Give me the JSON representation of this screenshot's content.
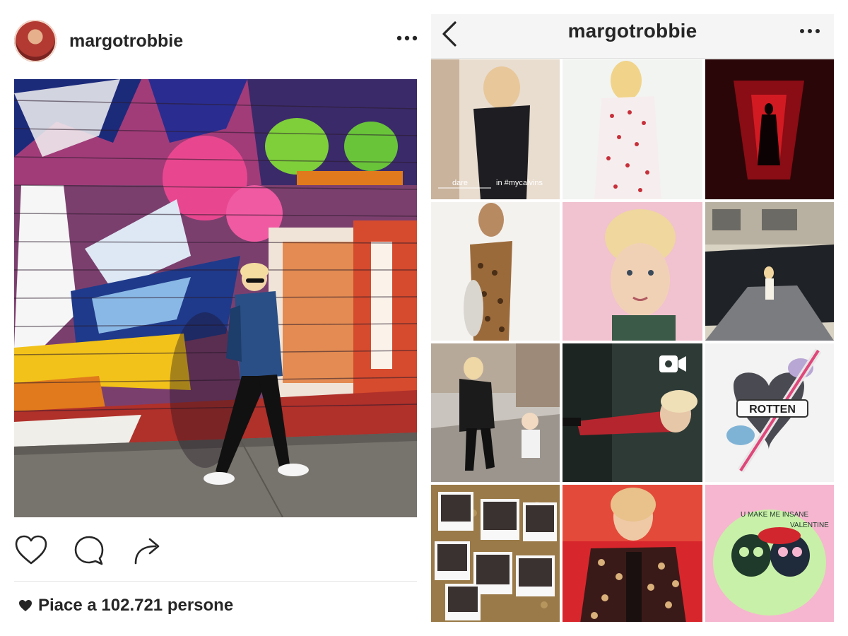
{
  "post": {
    "username": "margotrobbie",
    "likes_text": "Piace a 102.721 persone"
  },
  "profile": {
    "title": "margotrobbie",
    "tile1_caption_left": "dare",
    "tile1_caption_right": "in #mycalvins",
    "tile9_badge_text": "ROTTEN",
    "tile12_text_top": "U MAKE ME INSANE",
    "tile12_text_right": "VALENTINE"
  },
  "icons": {
    "more": "more-horizontal-icon",
    "back": "chevron-left-icon",
    "like": "heart-icon",
    "comment": "comment-bubble-icon",
    "share": "share-arrow-icon",
    "video": "video-camera-icon"
  },
  "colors": {
    "text": "#262626",
    "navbar": "#f5f5f5",
    "divider": "#e6e6e6"
  }
}
